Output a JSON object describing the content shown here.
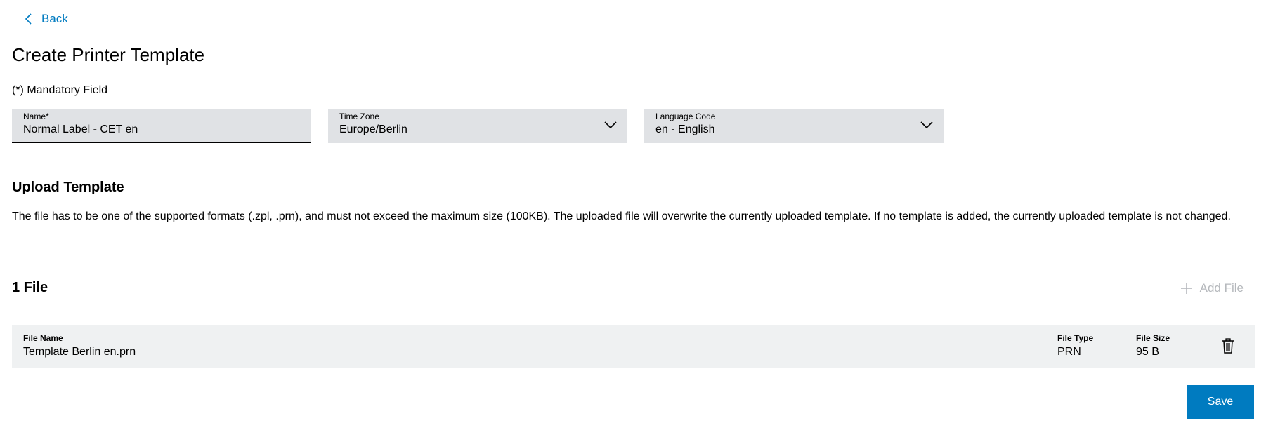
{
  "nav": {
    "back_label": "Back"
  },
  "header": {
    "title": "Create Printer Template",
    "mandatory_note": "(*) Mandatory Field"
  },
  "form": {
    "name": {
      "label": "Name*",
      "value": "Normal Label - CET en"
    },
    "time_zone": {
      "label": "Time Zone",
      "value": "Europe/Berlin"
    },
    "language_code": {
      "label": "Language Code",
      "value": "en - English"
    }
  },
  "upload": {
    "title": "Upload Template",
    "description": "The file has to be one of the supported formats (.zpl, .prn), and must not exceed the maximum size (100KB). The uploaded file will overwrite the currently uploaded template. If no template is added, the currently uploaded template is not changed."
  },
  "files": {
    "count_label": "1 File",
    "add_label": "Add File",
    "columns": {
      "name": "File Name",
      "type": "File Type",
      "size": "File Size"
    },
    "rows": [
      {
        "name": "Template Berlin en.prn",
        "type": "PRN",
        "size": "95 B"
      }
    ]
  },
  "actions": {
    "save_label": "Save"
  },
  "colors": {
    "accent": "#007bc0",
    "field_bg": "#e0e2e5",
    "row_bg": "#eff1f2",
    "disabled": "#b5b8bc"
  },
  "icons": {
    "back": "chevron-left-icon",
    "dropdown": "chevron-down-icon",
    "add": "plus-icon",
    "delete": "trash-icon"
  }
}
